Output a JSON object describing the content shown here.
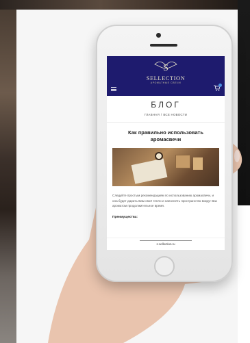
{
  "site": {
    "logo_text": "SELLECTION",
    "logo_subtitle": "АРОМАТНЫЕ СВЕЧИ",
    "page_title": "БЛОГ",
    "breadcrumb": [
      "ГЛАВНАЯ",
      "ВСЕ НОВОСТИ"
    ],
    "breadcrumb_sep": "/",
    "cart_count": "0"
  },
  "article": {
    "title": "Как правильно использовать аромасвечи",
    "body": "Следуйте простым рекомендациям по использованию аромасвечи, и она будет дарить Вам своё тепло и наполнять пространство вокруг Вас ароматом продолжительное время.",
    "advantages_label": "Преимущества:"
  },
  "browser": {
    "url": "s·sellection.ru"
  },
  "colors": {
    "header_bg": "#1e1b6e",
    "logo_gold": "#e6e2c9",
    "badge": "#4a8fe0"
  },
  "icons": [
    "menu-icon",
    "cart-icon",
    "logo-mark-icon"
  ]
}
